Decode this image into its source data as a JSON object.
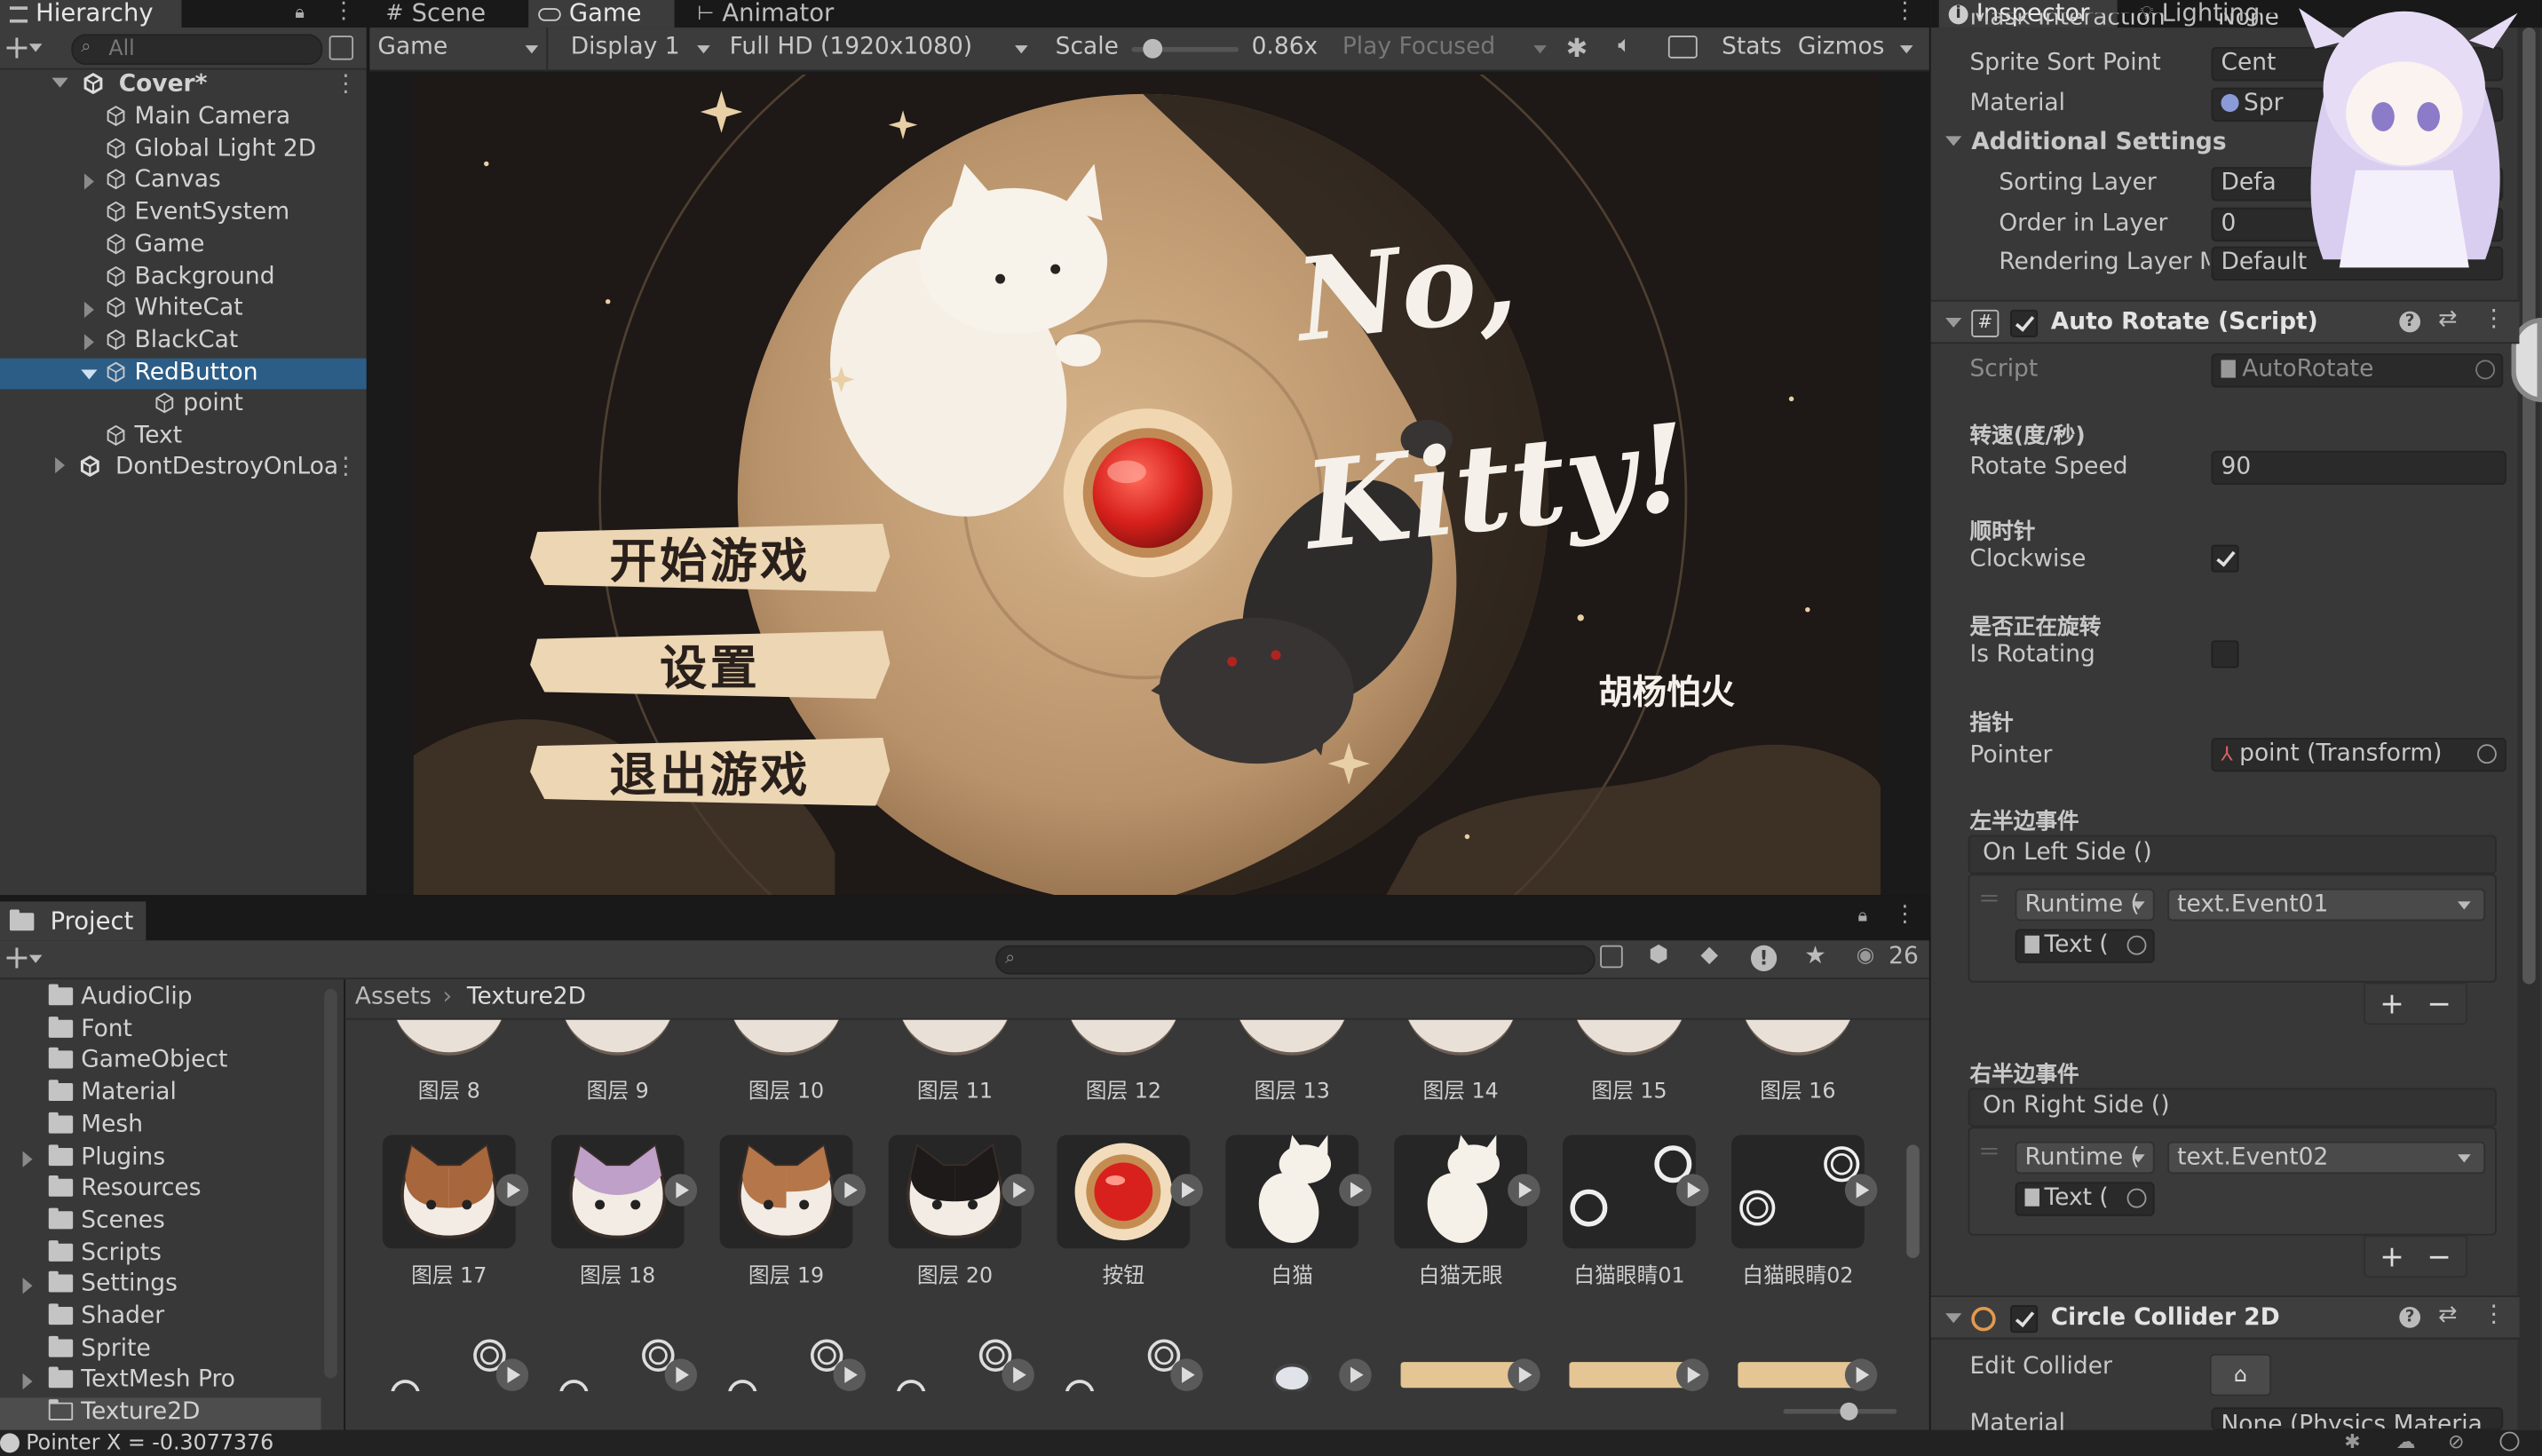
{
  "tabs": {
    "hierarchy": "Hierarchy",
    "scene": "Scene",
    "game": "Game",
    "animator": "Animator",
    "inspector": "Inspector",
    "lighting": "Lighting",
    "project": "Project"
  },
  "hierarchy": {
    "search_placeholder": "All",
    "scene_root": "Cover*",
    "items": [
      {
        "label": "Main Camera",
        "depth": 2,
        "expandable": false,
        "selected": false
      },
      {
        "label": "Global Light 2D",
        "depth": 2,
        "expandable": false,
        "selected": false
      },
      {
        "label": "Canvas",
        "depth": 2,
        "expandable": true,
        "selected": false
      },
      {
        "label": "EventSystem",
        "depth": 2,
        "expandable": false,
        "selected": false
      },
      {
        "label": "Game",
        "depth": 2,
        "expandable": false,
        "selected": false
      },
      {
        "label": "Background",
        "depth": 2,
        "expandable": false,
        "selected": false
      },
      {
        "label": "WhiteCat",
        "depth": 2,
        "expandable": true,
        "selected": false
      },
      {
        "label": "BlackCat",
        "depth": 2,
        "expandable": true,
        "selected": false
      },
      {
        "label": "RedButton",
        "depth": 2,
        "expandable": true,
        "selected": true
      },
      {
        "label": "point",
        "depth": 3,
        "expandable": false,
        "selected": false
      },
      {
        "label": "Text",
        "depth": 2,
        "expandable": false,
        "selected": false
      }
    ],
    "dont_destroy": "DontDestroyOnLoa"
  },
  "game_toolbar": {
    "view_dropdown": "Game",
    "display_dropdown": "Display 1",
    "resolution_dropdown": "Full HD (1920x1080)",
    "scale_label": "Scale",
    "scale_value": "0.86x",
    "scale_fraction": 0.2,
    "play_mode_dropdown": "Play Focused",
    "stats_label": "Stats",
    "gizmos_label": "Gizmos"
  },
  "game_view": {
    "title_line1": "No,",
    "title_line2": "Kitty!",
    "subtitle": "胡杨怕火",
    "menu": [
      "开始游戏",
      "设置",
      "退出游戏"
    ]
  },
  "project": {
    "count": "26",
    "breadcrumb": [
      "Assets",
      "Texture2D"
    ],
    "folders": [
      {
        "label": "AudioClip",
        "expandable": false,
        "selected": false
      },
      {
        "label": "Font",
        "expandable": false,
        "selected": false
      },
      {
        "label": "GameObject",
        "expandable": false,
        "selected": false
      },
      {
        "label": "Material",
        "expandable": false,
        "selected": false
      },
      {
        "label": "Mesh",
        "expandable": false,
        "selected": false
      },
      {
        "label": "Plugins",
        "expandable": true,
        "selected": false
      },
      {
        "label": "Resources",
        "expandable": false,
        "selected": false
      },
      {
        "label": "Scenes",
        "expandable": false,
        "selected": false
      },
      {
        "label": "Scripts",
        "expandable": false,
        "selected": false
      },
      {
        "label": "Settings",
        "expandable": true,
        "selected": false
      },
      {
        "label": "Shader",
        "expandable": false,
        "selected": false
      },
      {
        "label": "Sprite",
        "expandable": false,
        "selected": false
      },
      {
        "label": "TextMesh Pro",
        "expandable": true,
        "selected": false
      },
      {
        "label": "Texture2D",
        "expandable": false,
        "selected": true
      }
    ],
    "row1_labels": [
      "图层 8",
      "图层 9",
      "图层 10",
      "图层 11",
      "图层 12",
      "图层 13",
      "图层 14",
      "图层 15",
      "图层 16"
    ],
    "row2_labels": [
      "图层 17",
      "图层 18",
      "图层 19",
      "图层 20",
      "按钮",
      "白猫",
      "白猫无眼",
      "白猫眼睛01",
      "白猫眼睛02"
    ]
  },
  "inspector": {
    "cut_top": "Mask Interaction",
    "cut_top_value": "None",
    "sprite_sort_point_label": "Sprite Sort Point",
    "sprite_sort_point_value": "Cent",
    "material_label": "Material",
    "material_value": "Spr",
    "additional_settings": "Additional Settings",
    "sorting_layer_label": "Sorting Layer",
    "sorting_layer_value": "Defa",
    "order_in_layer_label": "Order in Layer",
    "order_in_layer_value": "0",
    "rendering_layer_label": "Rendering Layer M",
    "rendering_layer_value": "Default",
    "auto_rotate": {
      "title": "Auto Rotate (Script)",
      "script_label": "Script",
      "script_value": "AutoRotate",
      "speed_cn": "转速(度/秒)",
      "speed_label": "Rotate Speed",
      "speed_value": "90",
      "clockwise_cn": "顺时针",
      "clockwise_label": "Clockwise",
      "clockwise": true,
      "rotating_cn": "是否正在旋转",
      "rotating_label": "Is Rotating",
      "rotating": false,
      "pointer_cn": "指针",
      "pointer_label": "Pointer",
      "pointer_value": "point (Transform)",
      "left_cn": "左半边事件",
      "left_event": "On Left Side ()",
      "left_runtime": "Runtime (",
      "left_func": "text.Event01",
      "left_obj": "Text (",
      "right_cn": "右半边事件",
      "right_event": "On Right Side ()",
      "right_runtime": "Runtime (",
      "right_func": "text.Event02",
      "right_obj": "Text ("
    },
    "circle_collider": {
      "title": "Circle Collider 2D",
      "edit_label": "Edit Collider",
      "material_label": "Material",
      "material_value": "None (Physics Materia"
    }
  },
  "status_bar": {
    "text": "Pointer X = -0.3077376"
  },
  "colors": {
    "selection": "#2c5d87",
    "panel": "#383838",
    "background": "#191919",
    "game_bg": "#1c1715",
    "moon": "#c4a17a",
    "red_button": "#d8211c"
  }
}
